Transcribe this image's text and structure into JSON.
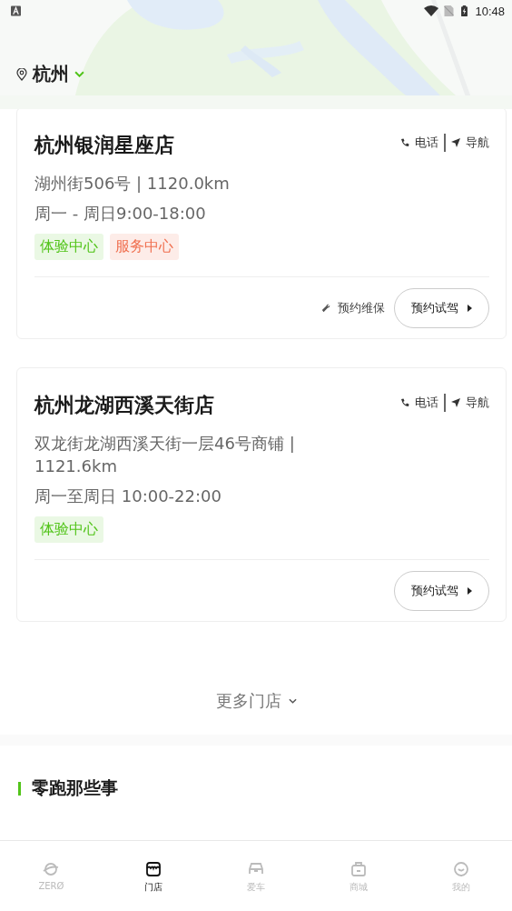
{
  "status_bar": {
    "time": "10:48"
  },
  "city": {
    "name": "杭州"
  },
  "stores": [
    {
      "name": "杭州银润星座店",
      "contacts": [
        {
          "kind": "phone",
          "label": "电话"
        },
        {
          "kind": "nav",
          "label": "导航"
        }
      ],
      "address": "湖州街506号 | 1120.0km",
      "hours": "周一 - 周日9:00-18:00",
      "tags": [
        {
          "kind": "experience",
          "label": "体验中心"
        },
        {
          "kind": "service",
          "label": "服务中心"
        }
      ],
      "maintenance": "预约维保",
      "test_drive": "预约试驾"
    },
    {
      "name": "杭州龙湖西溪天街店",
      "contacts": [
        {
          "kind": "phone",
          "label": "电话"
        },
        {
          "kind": "nav",
          "label": "导航"
        }
      ],
      "address": "双龙街龙湖西溪天街一层46号商铺 | 1121.6km",
      "hours": "周一至周日 10:00-22:00",
      "tags": [
        {
          "kind": "experience",
          "label": "体验中心"
        }
      ],
      "test_drive": "预约试驾"
    }
  ],
  "more": "更多门店",
  "section_title": "零跑那些事",
  "tabs": [
    {
      "kind": "planet",
      "label": "ZERØ",
      "selected": false
    },
    {
      "kind": "store",
      "label": "门店",
      "selected": true
    },
    {
      "kind": "car",
      "label": "爱车",
      "selected": false
    },
    {
      "kind": "bag",
      "label": "商城",
      "selected": false
    },
    {
      "kind": "smile",
      "label": "我的",
      "selected": false
    }
  ]
}
